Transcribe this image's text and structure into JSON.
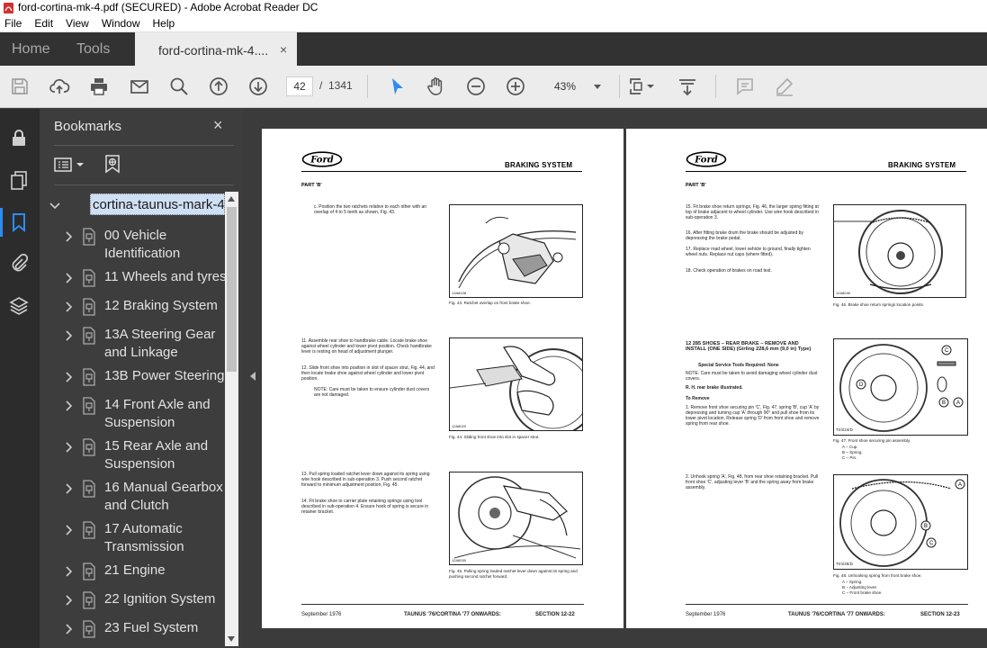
{
  "window": {
    "title": "ford-cortina-mk-4.pdf (SECURED) - Adobe Acrobat Reader DC"
  },
  "menu": {
    "items": [
      "File",
      "Edit",
      "View",
      "Window",
      "Help"
    ]
  },
  "tabs": {
    "home": "Home",
    "tools": "Tools",
    "document": "ford-cortina-mk-4....",
    "close": "×"
  },
  "toolbar": {
    "page_current": "42",
    "page_separator": "/",
    "page_total": "1341",
    "zoom": "43%",
    "icons": [
      "save-icon",
      "upload-cloud-icon",
      "print-icon",
      "mail-icon",
      "zoom-search-icon",
      "page-up-icon",
      "page-down-icon",
      "select-cursor-icon",
      "hand-icon",
      "zoom-out-icon",
      "zoom-in-icon",
      "page-fit-icon",
      "scroll-mode-icon",
      "comment-icon",
      "pen-icon"
    ]
  },
  "bookmarks": {
    "title": "Bookmarks",
    "close": "×",
    "root": "cortina-taunus-mark-4",
    "items": [
      {
        "label": "00 Vehicle Identification"
      },
      {
        "label": "11 Wheels and tyres"
      },
      {
        "label": "12  Braking System"
      },
      {
        "label": "13A Steering Gear and Linkage"
      },
      {
        "label": "13B Power Steering"
      },
      {
        "label": "14 Front Axle and Suspension"
      },
      {
        "label": "15 Rear Axle and Suspension"
      },
      {
        "label": "16 Manual Gearbox and Clutch"
      },
      {
        "label": "17 Automatic Transmission"
      },
      {
        "label": "21 Engine"
      },
      {
        "label": "22 Ignition System"
      },
      {
        "label": "23 Fuel System"
      }
    ]
  },
  "left_page": {
    "logo": "Ford",
    "header": "BRAKING SYSTEM",
    "part": "PART 'B'",
    "step_c": "c.  Position the two ratchets relative to each other with an overlap of 4 to 5 teeth as shown, Fig. 43.",
    "fig43_tag": "13A8108",
    "fig43_caption": "Fig. 43. Ratchet overlap on front brake shoe.",
    "step_11": "11.  Assemble rear shoe to handbrake cable. Locate brake shoe against wheel cylinder and lower pivot position. Check handbrake lever is resting on head of adjustment plunger.",
    "step_12": "12.  Slide front shoe into position in slot of spacer strut, Fig. 44, and then locate brake shoe against wheel cylinder and lower pivot position.",
    "note_12": "NOTE: Care must be taken to ensure cylinder dust covers are not damaged.",
    "fig44_tag": "12A8020",
    "fig44_caption": "Fig. 44. Sliding front shoe into slot in spacer strut.",
    "step_13": "13.  Pull spring loaded ratchet lever down against its spring using wire hook described in sub-operation 3. Push second ratchet forward to minimum adjustment position, Fig. 45.",
    "step_14": "14.  Fit brake shoe to carrier plate retaining springs using tool described in sub-operation 4. Ensure hook of spring is secure in retainer bracket.",
    "fig45_tag": "12A8030",
    "fig45_caption": "Fig. 45. Pulling spring loaded ratchet lever down against its spring and pushing second ratchet forward.",
    "footer_date": "September 1976",
    "footer_model": "TAUNUS '76/CORTINA '77 ONWARDS:",
    "footer_section": "SECTION 12-22"
  },
  "right_page": {
    "logo": "Ford",
    "header": "BRAKING SYSTEM",
    "part": "PART 'B'",
    "step_15": "15.  Fit brake shoe return springs, Fig. 46, the larger spring fitting at top of brake adjacent to wheel cylinder. Use wire hook described in sub-operation 3.",
    "step_16": "16.  After fitting brake drum the brake should be adjusted by depressing the brake pedal.",
    "step_17": "17.  Replace road wheel, lower vehicle to ground, finally tighten wheel nuts. Replace nut caps (where fitted).",
    "step_18": "18.  Check operation of brakes on road test.",
    "fig46_tag": "12A8040",
    "fig46_caption": "Fig. 46. Brake shoe return springs location points.",
    "op_heading": "12 285   SHOES – REAR BRAKE – REMOVE AND INSTALL (ONE SIDE) (Girling 228,6 mm (9,0 in) Type)",
    "op_tools": "Special Service Tools Required: None",
    "op_note": "NOTE: Care must be taken to avoid damaging wheel cylinder dust covers.",
    "op_illustrated": "R. H. rear brake illustrated.",
    "to_remove": "To Remove",
    "step_1": "1.  Remove front shoe securing pin 'C', Fig. 47, spring 'B', cup 'A' by depressing and turning cup 'A' through 90° and pull shoe from its lower pivot location. Release spring 'D' from front shoe and remove spring from rear shoe.",
    "fig47_tag": "TI/4/24/D",
    "fig47_caption": "Fig. 47. Front shoe securing pin assembly.",
    "fig47_legend": [
      "A – Cup.",
      "B – Spring.",
      "C – Pin."
    ],
    "step_2": "2.  Unhook spring 'A', Fig. 48, from rear shoe retaining bracket. Pull front shoe 'C', adjusting lever 'B' and the spring away from brake assembly.",
    "fig48_tag": "TI/4/25/D",
    "fig48_caption": "Fig. 48. Unhooking spring from front brake shoe.",
    "fig48_legend": [
      "A – Spring.",
      "B – Adjusting lever.",
      "C – Front brake shoe."
    ],
    "footer_date": "September 1976",
    "footer_model": "TAUNUS '76/CORTINA '77 ONWARDS:",
    "footer_section": "SECTION 12-23"
  },
  "colors": {
    "accent": "#2d8cf0",
    "toolbar_bg": "#ececec",
    "panel_bg": "#3d3d3d",
    "dark_bg": "#323232"
  }
}
